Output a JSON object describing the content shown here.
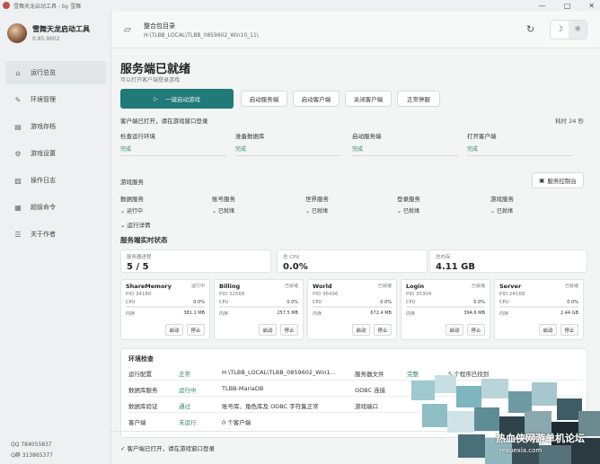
{
  "window": {
    "title": "雪舞天龙启动工具 - by 雪舞",
    "controls": [
      "—",
      "□",
      "✕"
    ]
  },
  "brand": {
    "name": "雪舞天龙启动工具",
    "version": "0.85.9602"
  },
  "nav": [
    {
      "label": "运行总览",
      "icon": "⌂",
      "active": true
    },
    {
      "label": "环境管理",
      "icon": "✎"
    },
    {
      "label": "游戏存档",
      "icon": "▤"
    },
    {
      "label": "游戏设置",
      "icon": "⚙"
    },
    {
      "label": "操作日志",
      "icon": "▧"
    },
    {
      "label": "超级命令",
      "icon": "▦"
    },
    {
      "label": "关于作者",
      "icon": "☰"
    }
  ],
  "contact": {
    "qq": "QQ 784055837",
    "qqgroup": "Q群 313865377"
  },
  "topbar": {
    "label": "整合包目录",
    "path": "H:\\TLBB_LOCAL\\TLBB_0859602_Win10_11\\",
    "refresh_icon": "↻",
    "theme_dark": "☽",
    "theme_light": "☼"
  },
  "status": {
    "title": "服务端已就绪",
    "subtitle": "可以打开客户端登录游戏"
  },
  "actions": {
    "one_click": "一键启动游戏",
    "start_server": "启动服务端",
    "start_client": "启动客户端",
    "close_client": "关闭客户端",
    "shutdown": "正常停服"
  },
  "progress": {
    "message": "客户端已打开，请在游戏窗口登录",
    "elapsed": "耗时 24 秒"
  },
  "checks": [
    {
      "label": "检查运行环境",
      "value": "完成"
    },
    {
      "label": "准备数据库",
      "value": "完成"
    },
    {
      "label": "启动服务端",
      "value": "完成"
    },
    {
      "label": "打开客户端",
      "value": "完成"
    }
  ],
  "services": {
    "header": "游戏服务",
    "console_button": "服务控制台",
    "items": [
      {
        "name": "数据服务",
        "state": "运行中"
      },
      {
        "name": "账号服务",
        "state": "已就绪"
      },
      {
        "name": "世界服务",
        "state": "已就绪"
      },
      {
        "name": "登录服务",
        "state": "已就绪"
      },
      {
        "name": "游戏服务",
        "state": "已就绪"
      }
    ],
    "detail_toggle": "运行详情"
  },
  "realtime": {
    "title": "服务端实时状态",
    "stats": [
      {
        "key": "服务器进程",
        "value": "5 / 5"
      },
      {
        "key": "总 CPU",
        "value": "0.0%"
      },
      {
        "key": "总内存",
        "value": "4.11 GB"
      }
    ],
    "processes": [
      {
        "name": "ShareMemory",
        "state": "运行中",
        "pid": "PID 34180",
        "cpu": "0.0%",
        "mem": "381.1 MB"
      },
      {
        "name": "Billing",
        "state": "已就绪",
        "pid": "PID 32568",
        "cpu": "0.0%",
        "mem": "257.5 MB"
      },
      {
        "name": "World",
        "state": "已就绪",
        "pid": "PID 36436",
        "cpu": "0.0%",
        "mem": "672.4 MB"
      },
      {
        "name": "Login",
        "state": "已就绪",
        "pid": "PID 35304",
        "cpu": "0.0%",
        "mem": "394.6 MB"
      },
      {
        "name": "Server",
        "state": "已就绪",
        "pid": "PID 24168",
        "cpu": "0.0%",
        "mem": "2.44 GB"
      }
    ],
    "cpu_label": "CPU",
    "mem_label": "内存",
    "start_label": "启动",
    "stop_label": "停止"
  },
  "env": {
    "title": "环境检查",
    "rows": [
      {
        "k1": "运行配置",
        "v1": "正常",
        "d1": "H:\\TLBB_LOCAL\\TLBB_0859602_Win1...",
        "k2": "服务器文件",
        "v2": "完整",
        "d2": "5 个程序已找到"
      },
      {
        "k1": "数据库服务",
        "v1": "运行中",
        "d1": "TLBB-MariaDB",
        "k2": "ODBC 连接",
        "v2": "",
        "d2": ""
      },
      {
        "k1": "数据库验证",
        "v1": "通过",
        "d1": "账号库、角色库及 ODBC 字符集正常",
        "k2": "游戏端口",
        "v2": "",
        "d2": ""
      },
      {
        "k1": "客户端",
        "v1": "未运行",
        "d1": "0 个客户端",
        "k2": "",
        "v2": "",
        "d2": ""
      }
    ]
  },
  "footer": {
    "message": "客户端已打开，请在游戏窗口登录"
  },
  "watermark": {
    "text": "热血侠网游单机论坛",
    "url": "rexuexia.com"
  },
  "colors": {
    "accent": "#1f7a78",
    "ok": "#2a8a5a"
  }
}
